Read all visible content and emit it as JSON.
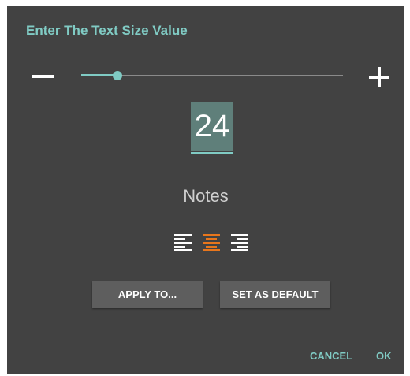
{
  "dialog": {
    "title": "Enter The Text Size Value",
    "slider": {
      "value_fraction": 0.14
    },
    "size_value": "24",
    "preview_text": "Notes",
    "alignment": {
      "selected": "center",
      "options": [
        {
          "name": "align-left-icon",
          "color": "#ffffff"
        },
        {
          "name": "align-center-icon",
          "color": "#e8761c"
        },
        {
          "name": "align-right-icon",
          "color": "#ffffff"
        }
      ]
    },
    "buttons": {
      "apply": "APPLY TO...",
      "set_default": "SET AS DEFAULT"
    },
    "actions": {
      "cancel": "CANCEL",
      "ok": "OK"
    },
    "accent_color": "#80cbc4",
    "selected_color": "#e8761c"
  }
}
